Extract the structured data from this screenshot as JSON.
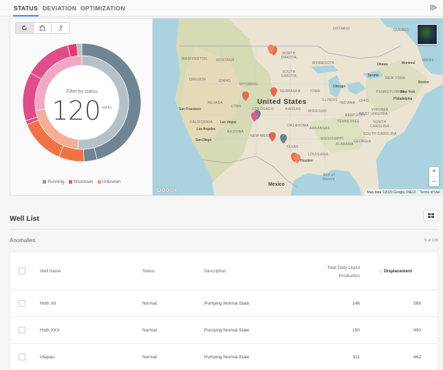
{
  "tabs": [
    {
      "label": "STATUS",
      "active": true
    },
    {
      "label": "DEVIATION",
      "active": false
    },
    {
      "label": "OPTIMIZATION",
      "active": false
    }
  ],
  "status_panel": {
    "view_buttons": [
      {
        "icon": "refresh-icon",
        "active": true
      },
      {
        "icon": "oil-pump-icon",
        "active": false
      },
      {
        "icon": "person-icon",
        "active": false
      }
    ],
    "filter_label": "Filter by status",
    "count": "120",
    "count_unit": "wells",
    "legend": [
      {
        "label": "Running",
        "color": "#8a9ca8"
      },
      {
        "label": "Shutdown",
        "color": "#e05a96"
      },
      {
        "label": "Unknown",
        "color": "#f2956c"
      }
    ],
    "colors": {
      "running_outer": "#6f8594",
      "running_inner": "#b4c1c9",
      "shutdown_outer": "#e04d8a",
      "shutdown_inner": "#f2a7c6",
      "unknown_outer": "#ef7346",
      "unknown_inner": "#f5ae95"
    }
  },
  "map": {
    "country_main": "United States",
    "country_south": "Mexico",
    "labels": [
      "ONTARIO",
      "QUEBEC",
      "WASHINGTON",
      "MONTANA",
      "NORTH DAKOTA",
      "MINNESOTA",
      "OREGON",
      "IDAHO",
      "WYOMING",
      "SOUTH DAKOTA",
      "NEVADA",
      "UTAH",
      "NEBRASKA",
      "IOWA",
      "COLORADO",
      "KANSAS",
      "MISSOURI",
      "INDIANA",
      "OHIO",
      "CALIFORNIA",
      "ARIZONA",
      "NEW MEXICO",
      "OKLAHOMA",
      "ARKANSAS",
      "TENNESSEE",
      "MISSISSIPPI",
      "ALABAMA",
      "GEORGIA",
      "LOUISIANA",
      "TEXAS",
      "NORTH CAROLINA",
      "VIRGINIA",
      "WEST VIRGINIA",
      "KENTUCKY",
      "SOUTH CAROLINA",
      "ILLINOIS",
      "PENNSYLVANIA",
      "NEW YORK",
      "MAINE",
      "Gulf of Mexico"
    ],
    "cities": [
      "Ottawa",
      "Montreal",
      "Toronto",
      "Chicago",
      "Boston",
      "New York",
      "Philadelphia",
      "San Francisco",
      "Las Vegas",
      "Los Angeles",
      "San Diego",
      "Houston"
    ],
    "google_label": "Google",
    "attribution": "Map data ©2020 Google, INEGI",
    "terms": "Terms of Use",
    "zoom_in": "+",
    "zoom_out": "−"
  },
  "well_list": {
    "title": "Well List",
    "section": "Anomalies",
    "count_text": "9 of 120",
    "columns": [
      "Well Name",
      "Status",
      "Description",
      "Total Daily Liquid Production",
      "Displacement"
    ],
    "rows": [
      {
        "name": "Hoth XII",
        "status": "Normal",
        "description": "Pumping Normal State",
        "production": "146",
        "displacement": "569"
      },
      {
        "name": "Hoth XXX",
        "status": "Normal",
        "description": "Pumping Normal State",
        "production": "190",
        "displacement": "490"
      },
      {
        "name": "Utapau",
        "status": "Normal",
        "description": "Pumping Normal State",
        "production": "311",
        "displacement": "462"
      }
    ]
  }
}
